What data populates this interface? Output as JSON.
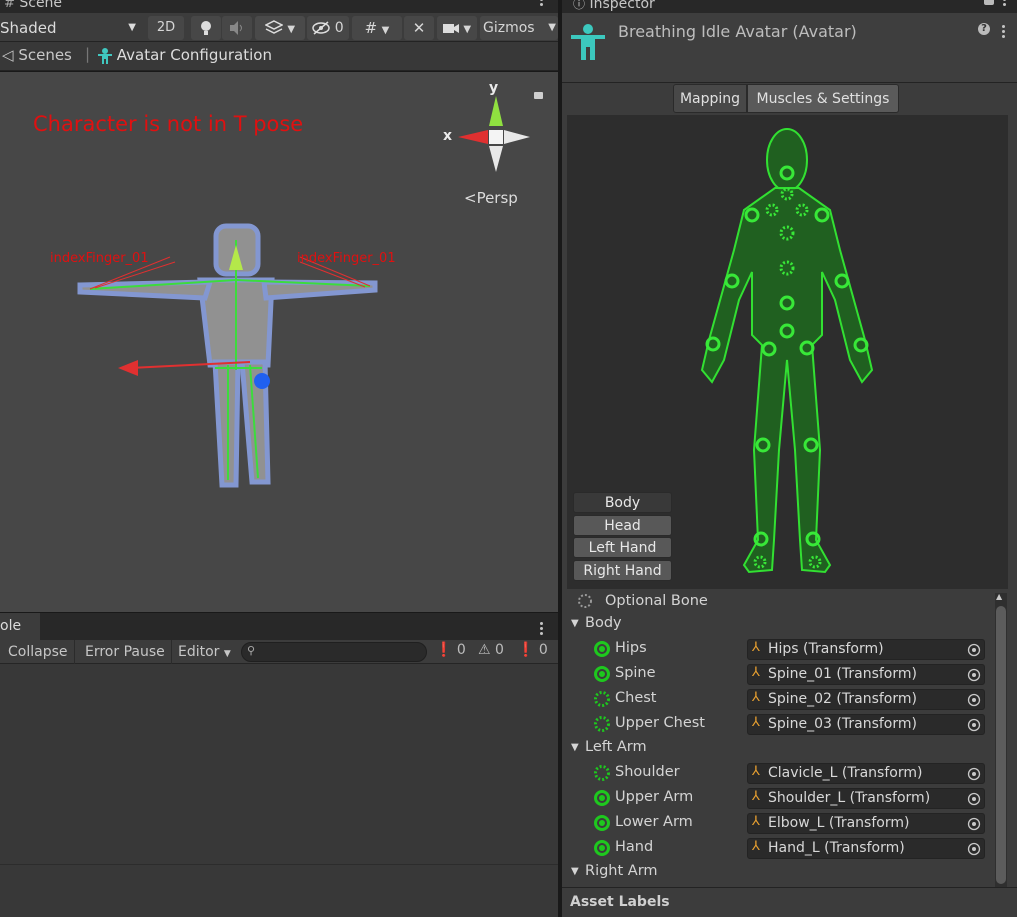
{
  "scene_tab": {
    "label": "Scene"
  },
  "inspector_tab": {
    "label": "Inspector"
  },
  "scene_toolbar": {
    "shading_mode": "Shaded",
    "btn_2d": "2D",
    "hidden_count": "0",
    "gizmos_label": "Gizmos"
  },
  "breadcrumb": {
    "scenes_label": "Scenes",
    "separator": "|",
    "avatar_config_label": "Avatar Configuration"
  },
  "scene_view": {
    "warning": "Character is not in T pose",
    "axis_y": "y",
    "axis_x": "x",
    "persp_label": "<Persp",
    "left_bone_label": "indexFinger_01",
    "right_bone_label": "indexFinger_01"
  },
  "console": {
    "tab_label": "ole",
    "collapse": "Collapse",
    "error_pause": "Error Pause",
    "editor": "Editor",
    "search_placeholder": "",
    "info_count": "0",
    "warning_count": "0",
    "error_count": "0"
  },
  "inspector": {
    "title": "Breathing Idle Avatar (Avatar)",
    "tabs": [
      {
        "label": "Mapping"
      },
      {
        "label": "Muscles & Settings"
      }
    ],
    "body_parts": [
      {
        "label": "Body"
      },
      {
        "label": "Head"
      },
      {
        "label": "Left Hand"
      },
      {
        "label": "Right Hand"
      }
    ],
    "optional_bone": "Optional Bone",
    "groups": [
      {
        "label": "Body",
        "bones": [
          {
            "name": "Hips",
            "value": "Hips (Transform)",
            "optional": false
          },
          {
            "name": "Spine",
            "value": "Spine_01 (Transform)",
            "optional": false
          },
          {
            "name": "Chest",
            "value": "Spine_02 (Transform)",
            "optional": true
          },
          {
            "name": "Upper Chest",
            "value": "Spine_03 (Transform)",
            "optional": true
          }
        ]
      },
      {
        "label": "Left Arm",
        "bones": [
          {
            "name": "Shoulder",
            "value": "Clavicle_L (Transform)",
            "optional": true
          },
          {
            "name": "Upper Arm",
            "value": "Shoulder_L (Transform)",
            "optional": false
          },
          {
            "name": "Lower Arm",
            "value": "Elbow_L (Transform)",
            "optional": false
          },
          {
            "name": "Hand",
            "value": "Hand_L (Transform)",
            "optional": false
          }
        ]
      },
      {
        "label": "Right Arm",
        "bones": []
      }
    ],
    "asset_labels": "Asset Labels"
  },
  "colors": {
    "accent_green": "#1ec81e",
    "warning_red": "#e01010"
  }
}
